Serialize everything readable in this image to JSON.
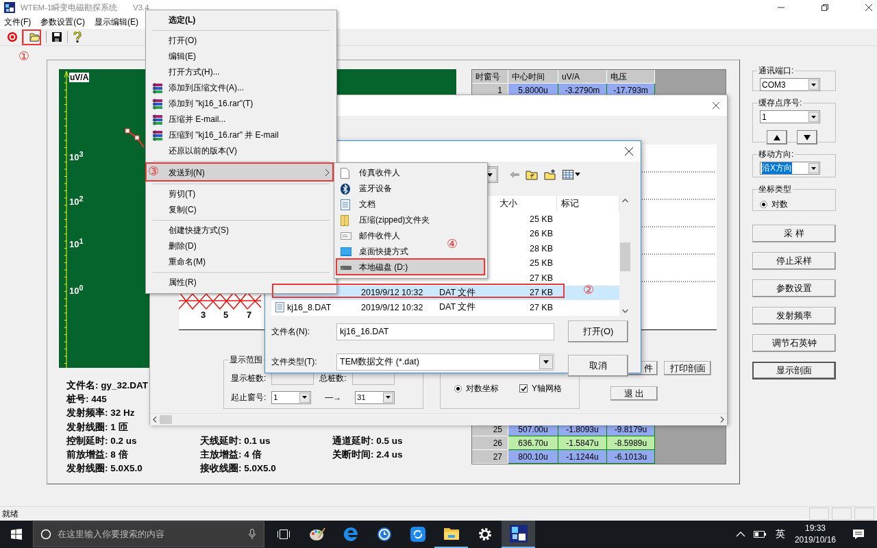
{
  "window": {
    "title": "WTEM-1瞬变电磁勘探系统",
    "version": "V3.4"
  },
  "menu": [
    {
      "label": "文件(F)"
    },
    {
      "label": "参数设置(C)"
    },
    {
      "label": "显示编辑(E)"
    }
  ],
  "toolbar": [
    {
      "kind": "stop"
    },
    {
      "kind": "open"
    },
    {
      "kind": "save"
    },
    {
      "kind": "help"
    }
  ],
  "plot": {
    "axis_label": "uV/A",
    "y_ticks": [
      "10$^{3}$",
      "10$^{2}$",
      "10$^{1}$",
      "10$^{0}$"
    ]
  },
  "data_table": {
    "columns": [
      "时窗号",
      "中心时间",
      "uV/A",
      "电压"
    ],
    "top_rows": [
      {
        "cells": [
          "1",
          "5.8000u",
          "-3.2790m",
          "-17.793m"
        ],
        "color": "#94aaf0"
      }
    ],
    "bottom_rows": [
      {
        "cells": [
          "25",
          "507.00u",
          "-1.8093u",
          "-9.8179u"
        ],
        "color": "#94aaf0"
      },
      {
        "cells": [
          "26",
          "636.70u",
          "-1.5847u",
          "-8.5989u"
        ],
        "color": "#bdeca8"
      },
      {
        "cells": [
          "27",
          "800.10u",
          "-1.1244u",
          "-6.1013u"
        ],
        "color": "#94aaf0"
      }
    ]
  },
  "file_info": [
    [
      "文件名: gy_32.DAT"
    ],
    [
      "桩号: 445"
    ],
    [
      "发射频率: 32 Hz"
    ],
    [
      "发射线圈: 1 匝"
    ],
    [
      "控制延时: 0.2 us",
      "天线延时: 0.1 us",
      "通道延时: 0.5 us"
    ],
    [
      "前放增益: 8 倍",
      "主放增益: 4 倍",
      "关断时间: 2.4 us"
    ],
    [
      "发射线圈: 5.0X5.0",
      "接收线圈: 5.0X5.0"
    ]
  ],
  "right_panel": {
    "port": {
      "label": "通讯端口:",
      "value": "COM3"
    },
    "buffer": {
      "label": "缓存点序号:",
      "value": "1"
    },
    "direction": {
      "label": "移动方向:",
      "value": "沿X方向",
      "focused": true
    },
    "coord": {
      "label": "坐标类型",
      "option": "对数",
      "selected": true
    },
    "buttons": [
      "采 样",
      "停止采样",
      "参数设置",
      "发射频率",
      "调节石英钟",
      "显示剖面"
    ]
  },
  "status_bar": {
    "text": "就绪"
  },
  "profile_dialog": {
    "x_labels": [
      "3",
      "5",
      "7"
    ],
    "range": {
      "title": "显示范围",
      "stake_label": "显示桩数:",
      "total_label": "总桩数:",
      "window_label": "起止窗号:",
      "from": "1",
      "arrow": "—→",
      "to": "31"
    },
    "coords": [
      {
        "label": "对数坐标",
        "selected": true
      }
    ],
    "grids": [
      {
        "label": "Y轴网格",
        "checked": true
      }
    ],
    "buttons": [
      "件",
      "打印剖面",
      "退 出"
    ]
  },
  "file_dialog": {
    "columns": [
      "大小",
      "标记"
    ],
    "files": [
      {
        "size": "25 KB",
        "selected": false
      },
      {
        "size": "26 KB",
        "selected": false
      },
      {
        "size": "28 KB",
        "selected": false
      },
      {
        "size": "25 KB",
        "selected": false
      },
      {
        "size": "27 KB",
        "selected": false
      },
      {
        "modified": "2019/9/12 10:32",
        "type": "DAT 文件",
        "size": "27 KB",
        "selected": true
      },
      {
        "name": "kj16_8.DAT",
        "modified": "2019/9/12 10:32",
        "type": "DAT 文件",
        "size": "27 KB",
        "selected": false
      }
    ],
    "filename_label": "文件名(N):",
    "filename": "kj16_16.DAT",
    "filetype_label": "文件类型(T):",
    "filetype": "TEM数据文件 (*.dat)",
    "open": "打开(O)",
    "cancel": "取消"
  },
  "context_menu": {
    "items": [
      {
        "kind": "item",
        "label": "选定(L)",
        "default": true,
        "archive": false,
        "selected": false
      },
      {
        "kind": "separator"
      },
      {
        "kind": "item",
        "label": "打开(O)",
        "default": false,
        "archive": false,
        "selected": false
      },
      {
        "kind": "item",
        "label": "编辑(E)",
        "default": false,
        "archive": false,
        "selected": false
      },
      {
        "kind": "item",
        "label": "打开方式(H)...",
        "default": false,
        "archive": false,
        "selected": false
      },
      {
        "kind": "item",
        "label": "添加到压缩文件(A)...",
        "default": false,
        "archive": true,
        "selected": false
      },
      {
        "kind": "item",
        "label": "添加到 \"kj16_16.rar\"(T)",
        "default": false,
        "archive": true,
        "selected": false
      },
      {
        "kind": "item",
        "label": "压缩并 E-mail...",
        "default": false,
        "archive": true,
        "selected": false
      },
      {
        "kind": "item",
        "label": "压缩到 \"kj16_16.rar\" 并 E-mail",
        "default": false,
        "archive": true,
        "selected": false
      },
      {
        "kind": "item",
        "label": "还原以前的版本(V)",
        "default": false,
        "archive": false,
        "selected": false
      },
      {
        "kind": "separator"
      },
      {
        "kind": "item",
        "label": "发送到(N)",
        "default": false,
        "archive": false,
        "selected": true,
        "submenu": true
      },
      {
        "kind": "separator"
      },
      {
        "kind": "item",
        "label": "剪切(T)",
        "default": false,
        "archive": false,
        "selected": false
      },
      {
        "kind": "item",
        "label": "复制(C)",
        "default": false,
        "archive": false,
        "selected": false
      },
      {
        "kind": "separator"
      },
      {
        "kind": "item",
        "label": "创建快捷方式(S)",
        "default": false,
        "archive": false,
        "selected": false
      },
      {
        "kind": "item",
        "label": "删除(D)",
        "default": false,
        "archive": false,
        "selected": false
      },
      {
        "kind": "item",
        "label": "重命名(M)",
        "default": false,
        "archive": false,
        "selected": false
      },
      {
        "kind": "separator"
      },
      {
        "kind": "item",
        "label": "属性(R)",
        "default": false,
        "archive": false,
        "selected": false
      }
    ]
  },
  "send_to": {
    "items": [
      {
        "kind": "blank",
        "label": "传真收件人",
        "selected": false
      },
      {
        "kind": "bluetooth",
        "label": "蓝牙设备",
        "selected": false
      },
      {
        "kind": "document",
        "label": "文档",
        "selected": false
      },
      {
        "kind": "zip",
        "label": "压缩(zipped)文件夹",
        "selected": false
      },
      {
        "kind": "mail",
        "label": "邮件收件人",
        "selected": false
      },
      {
        "kind": "desktop",
        "label": "桌面快捷方式",
        "selected": false
      },
      {
        "kind": "drive",
        "label": "本地磁盘 (D:)",
        "selected": true
      }
    ]
  },
  "annotations": [
    "①",
    "②",
    "③",
    "④"
  ],
  "taskbar": {
    "search_placeholder": "在这里输入你要搜索的内容",
    "apps": [
      {
        "kind": "task-view",
        "running": false,
        "active": false
      },
      {
        "kind": "paint",
        "running": false,
        "active": false
      },
      {
        "kind": "edge",
        "running": false,
        "active": false
      },
      {
        "kind": "clock",
        "running": false,
        "active": false
      },
      {
        "kind": "sync",
        "running": false,
        "active": false
      },
      {
        "kind": "folder",
        "running": true,
        "active": false
      },
      {
        "kind": "settings",
        "running": false,
        "active": false
      },
      {
        "kind": "cubes",
        "running": true,
        "active": true
      }
    ],
    "ime": "英",
    "time": "19:33",
    "date": "2019/10/16"
  }
}
